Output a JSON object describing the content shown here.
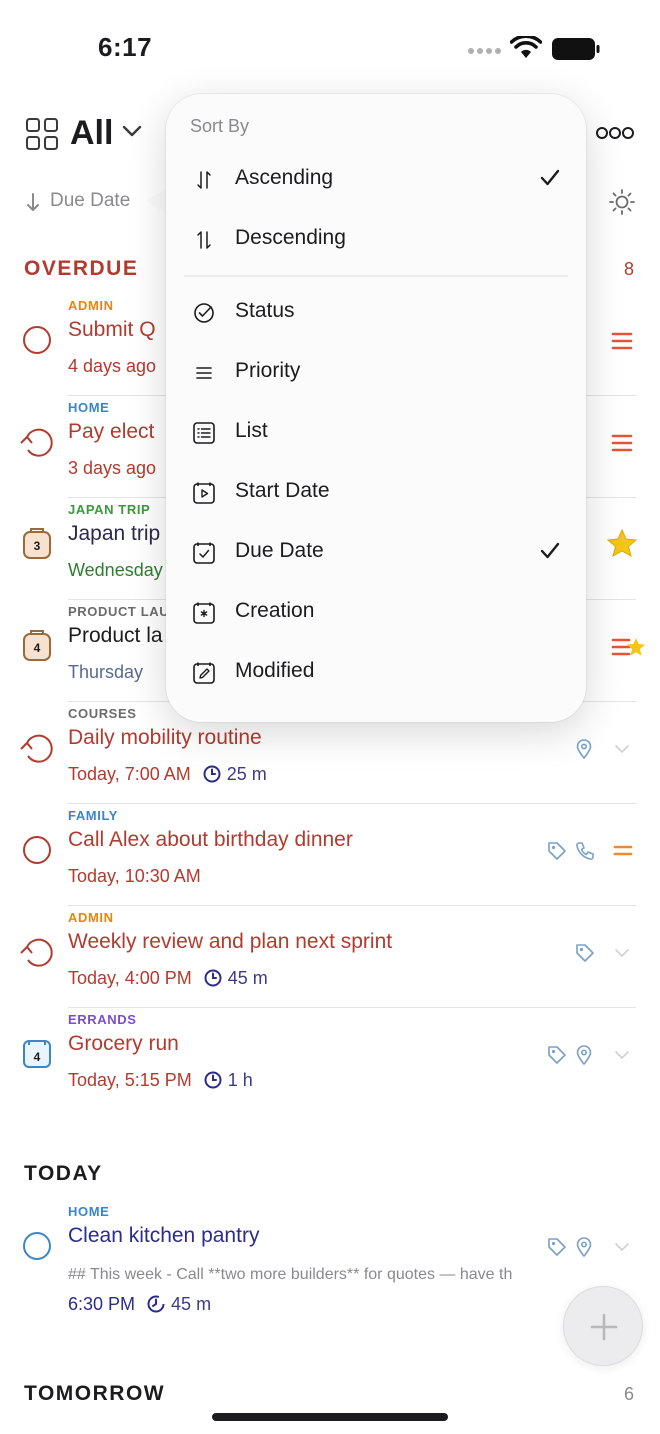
{
  "status_bar": {
    "time": "6:17"
  },
  "header": {
    "title": "All"
  },
  "sort_row": {
    "label": "Due Date"
  },
  "sections": {
    "overdue": {
      "title": "OVERDUE",
      "count": "8"
    },
    "today": {
      "title": "TODAY"
    },
    "tomorrow": {
      "title": "TOMORROW",
      "count": "6"
    }
  },
  "tasks": [
    {
      "list": "ADMIN",
      "list_color": "#e8860c",
      "title": "Submit Q",
      "sub": "4 days ago",
      "icon": "circle-icon"
    },
    {
      "list": "HOME",
      "list_color": "#3a86c8",
      "title": "Pay elect",
      "sub": "3 days ago",
      "icon": "repeat-icon"
    },
    {
      "list": "JAPAN TRIP",
      "list_color": "#3a9a3a",
      "title": "Japan trip",
      "sub": "Wednesday",
      "icon": "project-icon",
      "badge": "3"
    },
    {
      "list": "PRODUCT LAU",
      "list_color": "#6b6b6b",
      "title": "Product la",
      "sub": "Thursday",
      "icon": "project-icon",
      "badge": "4"
    },
    {
      "list": "COURSES",
      "list_color": "#6b6b6b",
      "title": "Daily mobility routine",
      "sub": "Today, 7:00 AM",
      "duration": "25 m",
      "icon": "repeat-icon"
    },
    {
      "list": "FAMILY",
      "list_color": "#3a86c8",
      "title": "Call Alex about birthday dinner",
      "sub": "Today, 10:30 AM",
      "icon": "circle-icon"
    },
    {
      "list": "ADMIN",
      "list_color": "#e8860c",
      "title": "Weekly review and plan next sprint",
      "sub": "Today, 4:00 PM",
      "duration": "45 m",
      "icon": "repeat-icon"
    },
    {
      "list": "ERRANDS",
      "list_color": "#7a4fc8",
      "title": "Grocery run",
      "sub": "Today, 5:15 PM",
      "duration": "1 h",
      "icon": "calendar-icon",
      "badge": "4"
    }
  ],
  "today_task": {
    "list": "HOME",
    "list_color": "#3a86c8",
    "title": "Clean kitchen pantry",
    "note": "## This week - Call **two more builders** for quotes — have th",
    "sub": "6:30 PM",
    "duration": "45 m"
  },
  "menu": {
    "header": "Sort By",
    "direction": [
      {
        "label": "Ascending",
        "checked": true,
        "icon": "sort-ascending-icon"
      },
      {
        "label": "Descending",
        "checked": false,
        "icon": "sort-descending-icon"
      }
    ],
    "fields": [
      {
        "label": "Status",
        "checked": false,
        "icon": "status-icon"
      },
      {
        "label": "Priority",
        "checked": false,
        "icon": "priority-icon"
      },
      {
        "label": "List",
        "checked": false,
        "icon": "list-icon"
      },
      {
        "label": "Start Date",
        "checked": false,
        "icon": "start-date-icon"
      },
      {
        "label": "Due Date",
        "checked": true,
        "icon": "due-date-icon"
      },
      {
        "label": "Creation",
        "checked": false,
        "icon": "creation-icon"
      },
      {
        "label": "Modified",
        "checked": false,
        "icon": "modified-icon"
      }
    ]
  },
  "colors": {
    "overdue": "#b23b2f",
    "navy": "#2c2c8a",
    "priority": "#e2553c",
    "star": "#f5c518",
    "meta_icon": "#7aa0c8"
  }
}
